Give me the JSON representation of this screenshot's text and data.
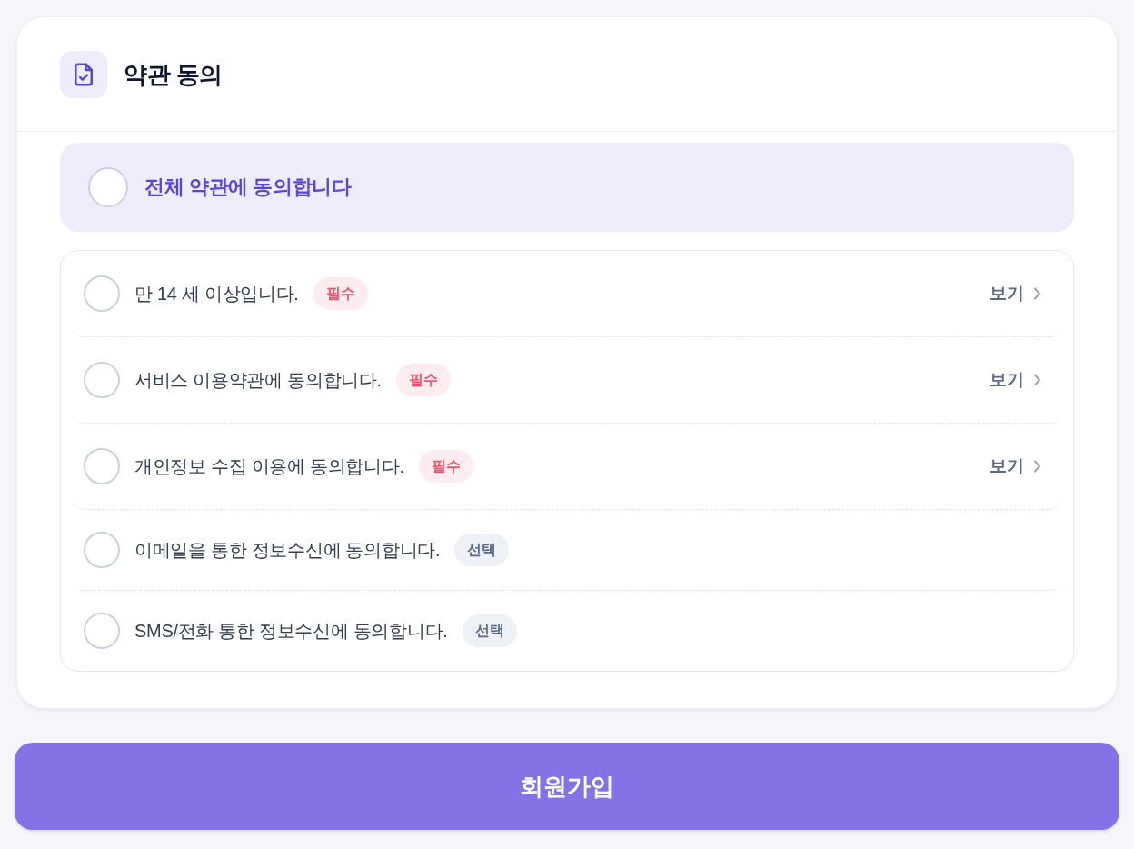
{
  "header": {
    "title": "약관 동의"
  },
  "agree_all": {
    "label": "전체 약관에 동의합니다",
    "checked": false
  },
  "terms": [
    {
      "label": "만 14 세 이상입니다.",
      "checked": false,
      "badge": {
        "label": "필수",
        "kind": "required"
      },
      "view_link": "보기"
    },
    {
      "label": "서비스 이용약관에 동의합니다.",
      "checked": false,
      "badge": {
        "label": "필수",
        "kind": "required"
      },
      "view_link": "보기"
    },
    {
      "label": "개인정보 수집 이용에 동의합니다.",
      "checked": false,
      "badge": {
        "label": "필수",
        "kind": "required"
      },
      "view_link": "보기"
    },
    {
      "label": "이메일을 통한 정보수신에 동의합니다.",
      "checked": false,
      "badge": {
        "label": "선택",
        "kind": "optional"
      }
    },
    {
      "label": "SMS/전화 통한 정보수신에 동의합니다.",
      "checked": false,
      "badge": {
        "label": "선택",
        "kind": "optional"
      }
    }
  ],
  "submit_button": {
    "label": "회원가입"
  }
}
